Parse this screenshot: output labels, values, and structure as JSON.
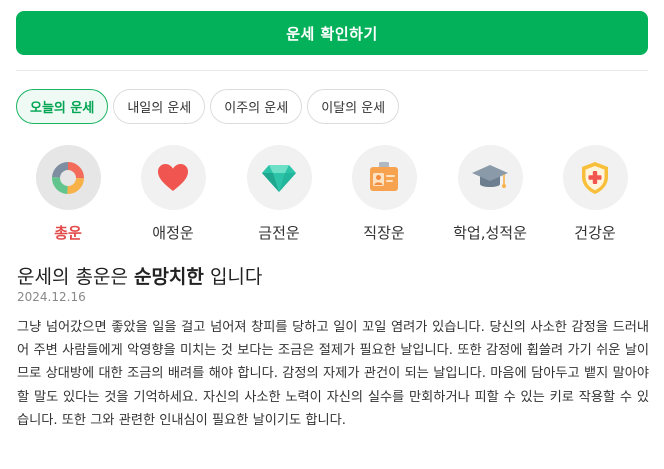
{
  "cta": {
    "label": "운세 확인하기"
  },
  "tabs": [
    {
      "label": "오늘의 운세",
      "active": true
    },
    {
      "label": "내일의 운세",
      "active": false
    },
    {
      "label": "이주의 운세",
      "active": false
    },
    {
      "label": "이달의 운세",
      "active": false
    }
  ],
  "categories": [
    {
      "label": "총운",
      "icon": "donut-chart-icon",
      "active": true
    },
    {
      "label": "애정운",
      "icon": "heart-icon",
      "active": false
    },
    {
      "label": "금전운",
      "icon": "diamond-icon",
      "active": false
    },
    {
      "label": "직장운",
      "icon": "id-badge-icon",
      "active": false
    },
    {
      "label": "학업,성적운",
      "icon": "graduation-cap-icon",
      "active": false
    },
    {
      "label": "건강운",
      "icon": "health-shield-icon",
      "active": false
    }
  ],
  "result": {
    "title_prefix": "운세의 총운은",
    "title_emphasis": "순망치한",
    "title_suffix": "입니다",
    "date": "2024.12.16",
    "description": "그냥 넘어갔으면 좋았을 일을 걸고 넘어져 창피를 당하고 일이 꼬일 염려가 있습니다. 당신의 사소한 감정을 드러내어 주변 사람들에게 악영향을 미치는 것 보다는 조금은 절제가 필요한 날입니다. 또한 감정에 휩쓸려 가기 쉬운 날이므로 상대방에 대한 조금의 배려를 해야 합니다. 감정의 자제가 관건이 되는 날입니다. 마음에 담아두고 뱉지 말아야 할 말도 있다는 것을 기억하세요. 자신의 사소한 노력이 자신의 실수를 만회하거나 피할 수 있는 키로 작용할 수 있습니다. 또한 그와 관련한 인내심이 필요한 날이기도 합니다."
  },
  "colors": {
    "primary_green": "#03b15a",
    "active_red": "#e34b4b",
    "heart_red": "#f0564f",
    "diamond_teal": "#2cc4a8",
    "badge_orange": "#f7a24e",
    "cap_gray": "#8a9aa8",
    "shield_yellow": "#f8bf3b"
  }
}
